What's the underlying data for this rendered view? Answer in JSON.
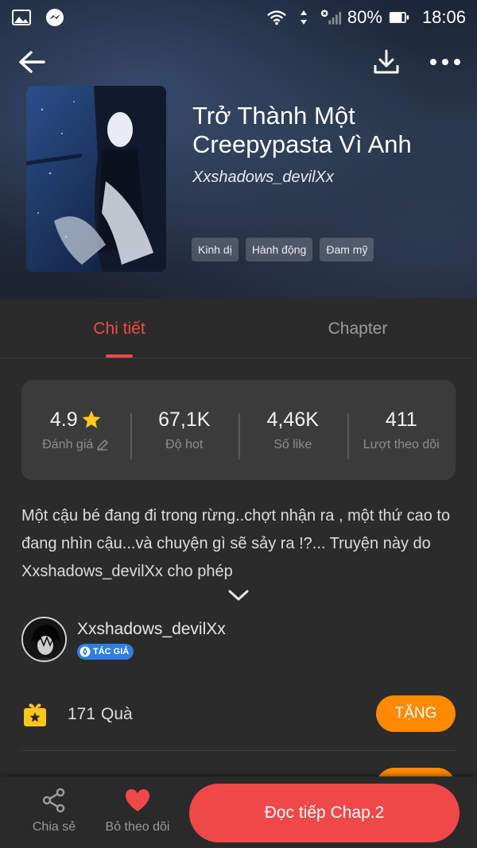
{
  "status_bar": {
    "battery": "80%",
    "time": "18:06"
  },
  "header": {
    "title": "Trở Thành Một Creepypasta Vì Anh",
    "author": "Xxshadows_devilXx",
    "tags": [
      "Kinh dị",
      "Hành động",
      "Đam mỹ"
    ]
  },
  "tabs": [
    {
      "label": "Chi tiết",
      "active": true
    },
    {
      "label": "Chapter",
      "active": false
    }
  ],
  "stats": [
    {
      "value": "4.9",
      "label": "Đánh giá"
    },
    {
      "value": "67,1K",
      "label": "Độ hot"
    },
    {
      "value": "4,46K",
      "label": "Số like"
    },
    {
      "value": "411",
      "label": "Lượt theo dõi"
    }
  ],
  "description": "Một cậu bé đang đi trong rừng..chợt nhận ra , một thứ cao to đang nhìn cậu...và chuyện gì sẽ sảy ra !?... Truyện này do Xxshadows_devilXx cho phép",
  "author_row": {
    "name": "Xxshadows_devilXx",
    "badge": "TÁC GIẢ"
  },
  "gifts": {
    "count": "171",
    "label": "Quà",
    "button": "TẶNG"
  },
  "bottom_bar": {
    "share_label": "Chia sẻ",
    "unfollow_label": "Bỏ theo dõi",
    "read_button": "Đọc tiếp Chap.2"
  },
  "colors": {
    "accent_red": "#ef4a4a",
    "accent_orange": "#ff8a00",
    "badge_blue": "#2f7fe0",
    "star_yellow": "#ffc61a"
  }
}
